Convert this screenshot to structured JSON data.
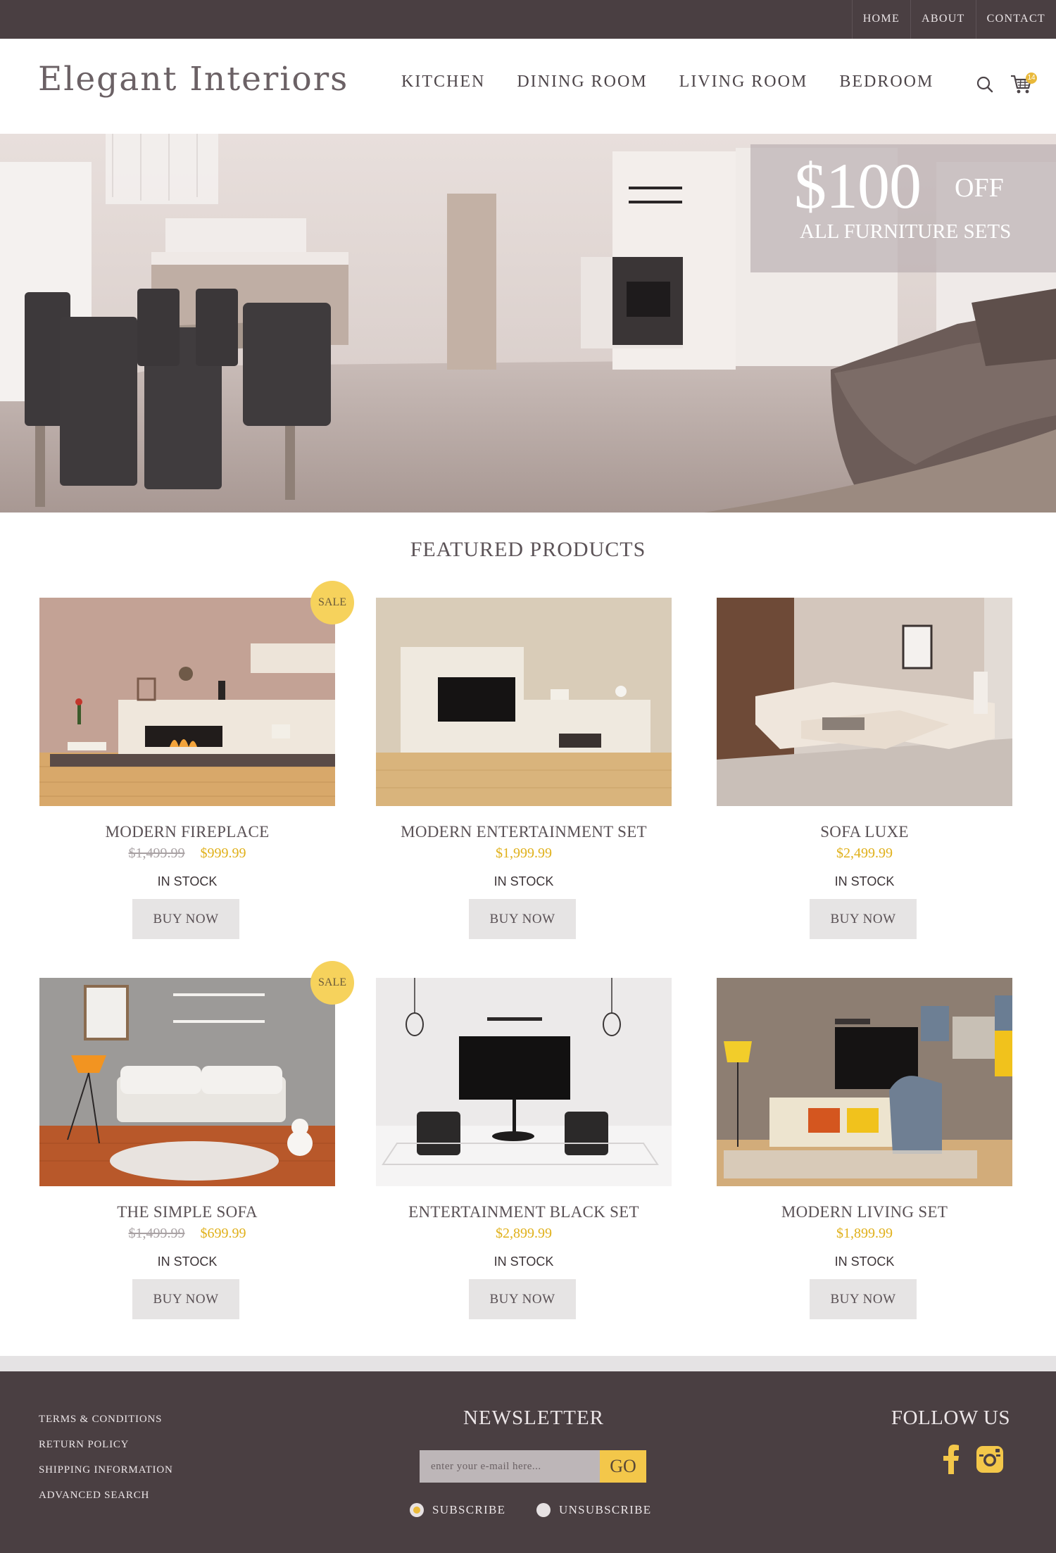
{
  "topbar": {
    "links": [
      "HOME",
      "ABOUT",
      "CONTACT"
    ]
  },
  "header": {
    "logo": "Elegant Interiors",
    "nav": [
      "KITCHEN",
      "DINING ROOM",
      "LIVING ROOM",
      "BEDROOM"
    ],
    "cart_count": "14",
    "icons": [
      "search-icon",
      "cart-icon"
    ]
  },
  "hero": {
    "promo_amount": "$100",
    "promo_off": "OFF",
    "promo_sub": "ALL FURNITURE SETS"
  },
  "featured": {
    "title": "FEATURED PRODUCTS",
    "products": [
      {
        "name": "MODERN FIREPLACE",
        "old_price": "$1,499.99",
        "price": "$999.99",
        "stock": "IN STOCK",
        "button": "BUY NOW",
        "badge": "SALE"
      },
      {
        "name": "MODERN ENTERTAINMENT SET",
        "old_price": "",
        "price": "$1,999.99",
        "stock": "IN STOCK",
        "button": "BUY NOW",
        "badge": ""
      },
      {
        "name": "SOFA LUXE",
        "old_price": "",
        "price": "$2,499.99",
        "stock": "IN STOCK",
        "button": "BUY NOW",
        "badge": ""
      },
      {
        "name": "THE SIMPLE SOFA",
        "old_price": "$1,499.99",
        "price": "$699.99",
        "stock": "IN STOCK",
        "button": "BUY NOW",
        "badge": "SALE"
      },
      {
        "name": "ENTERTAINMENT BLACK SET",
        "old_price": "",
        "price": "$2,899.99",
        "stock": "IN STOCK",
        "button": "BUY NOW",
        "badge": ""
      },
      {
        "name": "MODERN LIVING SET",
        "old_price": "",
        "price": "$1,899.99",
        "stock": "IN STOCK",
        "button": "BUY NOW",
        "badge": ""
      }
    ]
  },
  "footer": {
    "links": [
      "TERMS & CONDITIONS",
      "RETURN POLICY",
      "SHIPPING INFORMATION",
      "ADVANCED SEARCH"
    ],
    "newsletter": {
      "title": "NEWSLETTER",
      "placeholder": "enter your e-mail here...",
      "button": "GO",
      "options": [
        "SUBSCRIBE",
        "UNSUBSCRIBE"
      ],
      "selected": "SUBSCRIBE"
    },
    "follow": {
      "title": "FOLLOW US",
      "icons": [
        "facebook-icon",
        "instagram-icon"
      ]
    }
  },
  "colors": {
    "dark_bar": "#4a3f42",
    "accent_yellow": "#f3c74a",
    "price_yellow": "#e0b019",
    "sale_badge": "#f6d25c",
    "button_gray": "#e6e4e4"
  }
}
